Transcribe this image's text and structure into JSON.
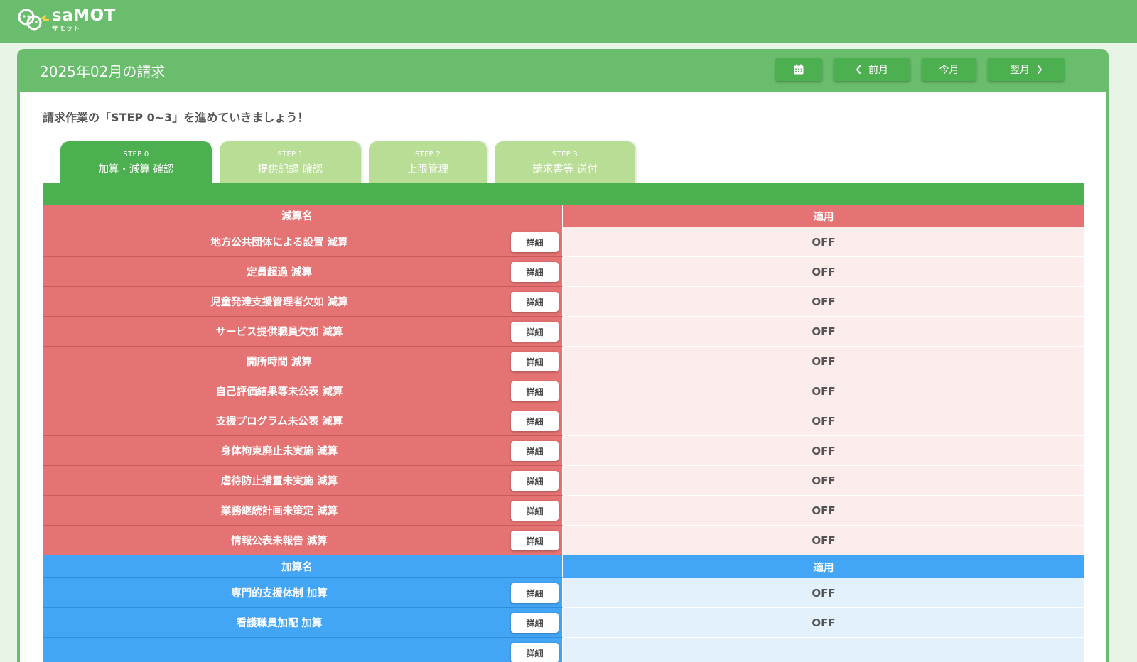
{
  "app": {
    "logo_text": "saMOT",
    "logo_sub": "サモット"
  },
  "header": {
    "title": "2025年02月の請求",
    "prev_label": "前月",
    "current_label": "今月",
    "next_label": "翌月"
  },
  "intro": "請求作業の「STEP 0~3」を進めていきましょう！",
  "tabs": [
    {
      "step": "STEP 0",
      "label": "加算・減算 確認",
      "active": true
    },
    {
      "step": "STEP 1",
      "label": "提供記録 確認",
      "active": false
    },
    {
      "step": "STEP 2",
      "label": "上限管理",
      "active": false
    },
    {
      "step": "STEP 3",
      "label": "請求書等 送付",
      "active": false
    }
  ],
  "reductions": {
    "header_name": "減算名",
    "header_apply": "適用",
    "detail_label": "詳細",
    "rows": [
      {
        "name": "地方公共団体による設置 減算",
        "value": "OFF"
      },
      {
        "name": "定員超過 減算",
        "value": "OFF"
      },
      {
        "name": "児童発達支援管理者欠如 減算",
        "value": "OFF"
      },
      {
        "name": "サービス提供職員欠如 減算",
        "value": "OFF"
      },
      {
        "name": "開所時間 減算",
        "value": "OFF"
      },
      {
        "name": "自己評価結果等未公表 減算",
        "value": "OFF"
      },
      {
        "name": "支援プログラム未公表 減算",
        "value": "OFF"
      },
      {
        "name": "身体拘束廃止未実施 減算",
        "value": "OFF"
      },
      {
        "name": "虐待防止措置未実施 減算",
        "value": "OFF"
      },
      {
        "name": "業務継続計画未策定 減算",
        "value": "OFF"
      },
      {
        "name": "情報公表未報告 減算",
        "value": "OFF"
      }
    ]
  },
  "additions": {
    "header_name": "加算名",
    "header_apply": "適用",
    "detail_label": "詳細",
    "rows": [
      {
        "name": "専門的支援体制 加算",
        "value": "OFF"
      },
      {
        "name": "看護職員加配 加算",
        "value": "OFF"
      },
      {
        "name": "",
        "value": ""
      }
    ]
  },
  "colors": {
    "brand_green": "#6abd6c",
    "active_green": "#4caf50",
    "inactive_tab": "#b8dd94",
    "reduction_red": "#e57373",
    "addition_blue": "#42a5f5"
  },
  "icons": {
    "calendar": "calendar-icon",
    "prev": "chevron-left-icon",
    "next": "chevron-right-icon"
  }
}
